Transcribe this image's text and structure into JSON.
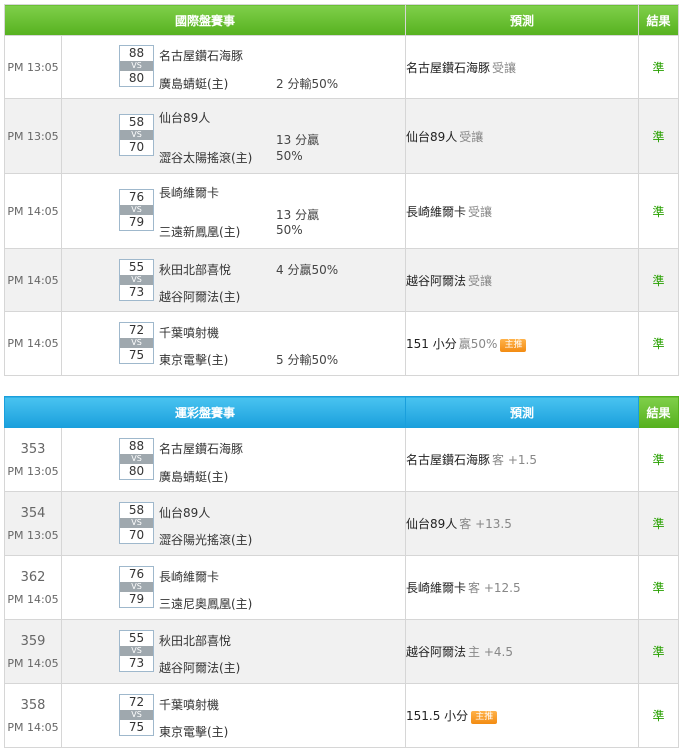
{
  "intl": {
    "header": {
      "league": "國際盤賽事",
      "predict": "預測",
      "result": "結果"
    },
    "rows": [
      {
        "time": "PM 13:05",
        "score_home": "88",
        "vs": "VS",
        "score_away": "80",
        "team_home": "名古屋鑽石海豚",
        "team_away": "廣島蜻蜓(主)",
        "odds1": "",
        "odds2": "2 分輸50%",
        "pick": "名古屋鑽石海豚",
        "pick_note": "受讓",
        "badge": "",
        "result": "準"
      },
      {
        "time": "PM 13:05",
        "score_home": "58",
        "vs": "VS",
        "score_away": "70",
        "team_home": "仙台89人",
        "team_away": "澀谷太陽搖滾(主)",
        "odds1": "13 分贏",
        "odds2": "50%",
        "pick": "仙台89人",
        "pick_note": "受讓",
        "badge": "",
        "result": "準"
      },
      {
        "time": "PM 14:05",
        "score_home": "76",
        "vs": "VS",
        "score_away": "79",
        "team_home": "長崎維爾卡",
        "team_away": "三遠新鳳凰(主)",
        "odds1": "13 分贏",
        "odds2": "50%",
        "pick": "長崎維爾卡",
        "pick_note": "受讓",
        "badge": "",
        "result": "準"
      },
      {
        "time": "PM 14:05",
        "score_home": "55",
        "vs": "VS",
        "score_away": "73",
        "team_home": "秋田北部喜悅",
        "team_away": "越谷阿爾法(主)",
        "odds1": "4 分贏50%",
        "odds2": "",
        "pick": "越谷阿爾法",
        "pick_note": "受讓",
        "badge": "",
        "result": "準"
      },
      {
        "time": "PM 14:05",
        "score_home": "72",
        "vs": "VS",
        "score_away": "75",
        "team_home": "千葉噴射機",
        "team_away": "東京電擊(主)",
        "odds1": "",
        "odds2": "5 分輸50%",
        "pick": "151 小分",
        "pick_note": "贏50%",
        "badge": "主推",
        "result": "準"
      }
    ]
  },
  "lottery": {
    "header": {
      "league": "運彩盤賽事",
      "predict": "預測",
      "result": "結果"
    },
    "rows": [
      {
        "id": "353",
        "time": "PM 13:05",
        "score_home": "88",
        "vs": "VS",
        "score_away": "80",
        "team_home": "名古屋鑽石海豚",
        "team_away": "廣島蜻蜓(主)",
        "pick": "名古屋鑽石海豚",
        "pick_note": "客 +1.5",
        "badge": "",
        "result": "準"
      },
      {
        "id": "354",
        "time": "PM 13:05",
        "score_home": "58",
        "vs": "VS",
        "score_away": "70",
        "team_home": "仙台89人",
        "team_away": "澀谷陽光搖滾(主)",
        "pick": "仙台89人",
        "pick_note": "客 +13.5",
        "badge": "",
        "result": "準"
      },
      {
        "id": "362",
        "time": "PM 14:05",
        "score_home": "76",
        "vs": "VS",
        "score_away": "79",
        "team_home": "長崎維爾卡",
        "team_away": "三遠尼奧鳳凰(主)",
        "pick": "長崎維爾卡",
        "pick_note": "客 +12.5",
        "badge": "",
        "result": "準"
      },
      {
        "id": "359",
        "time": "PM 14:05",
        "score_home": "55",
        "vs": "VS",
        "score_away": "73",
        "team_home": "秋田北部喜悅",
        "team_away": "越谷阿爾法(主)",
        "pick": "越谷阿爾法",
        "pick_note": "主 +4.5",
        "badge": "",
        "result": "準"
      },
      {
        "id": "358",
        "time": "PM 14:05",
        "score_home": "72",
        "vs": "VS",
        "score_away": "75",
        "team_home": "千葉噴射機",
        "team_away": "東京電擊(主)",
        "pick": "151.5 小分",
        "pick_note": "",
        "badge": "主推",
        "result": "準"
      }
    ]
  }
}
